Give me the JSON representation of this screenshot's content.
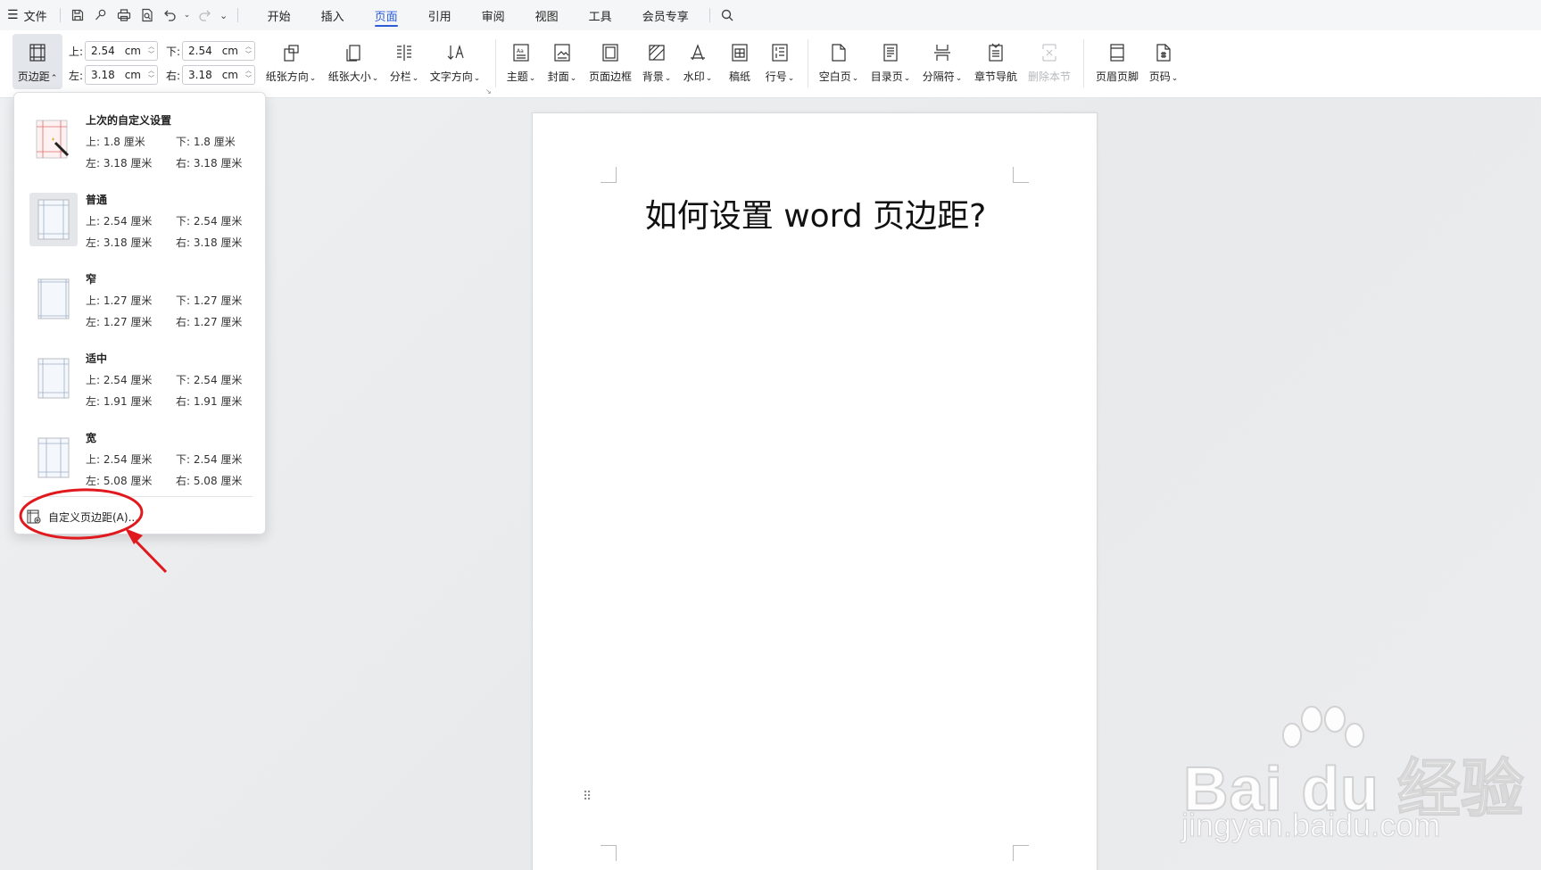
{
  "menubar": {
    "file_label": "文件",
    "tabs": [
      {
        "label": "开始"
      },
      {
        "label": "插入"
      },
      {
        "label": "页面"
      },
      {
        "label": "引用"
      },
      {
        "label": "审阅"
      },
      {
        "label": "视图"
      },
      {
        "label": "工具"
      },
      {
        "label": "会员专享"
      }
    ],
    "active_tab": "页面"
  },
  "ribbon": {
    "margins_button": "页边距",
    "fields": {
      "top": {
        "label": "上:",
        "value": "2.54",
        "unit": "cm"
      },
      "bottom": {
        "label": "下:",
        "value": "2.54",
        "unit": "cm"
      },
      "left": {
        "label": "左:",
        "value": "3.18",
        "unit": "cm"
      },
      "right": {
        "label": "右:",
        "value": "3.18",
        "unit": "cm"
      }
    },
    "buttons": {
      "orientation": "纸张方向",
      "size": "纸张大小",
      "columns": "分栏",
      "text_direction": "文字方向",
      "theme": "主题",
      "cover": "封面",
      "page_border": "页面边框",
      "background": "背景",
      "watermark": "水印",
      "manuscript": "稿纸",
      "line_number": "行号",
      "blank_page": "空白页",
      "toc_page": "目录页",
      "breaks": "分隔符",
      "chapter_nav": "章节导航",
      "delete_section": "删除本节",
      "header_footer": "页眉页脚",
      "page_number": "页码"
    }
  },
  "dropdown": {
    "presets": [
      {
        "name": "上次的自定义设置",
        "top": "上: 1.8 厘米",
        "bottom": "下: 1.8 厘米",
        "left": "左: 3.18 厘米",
        "right": "右: 3.18 厘米"
      },
      {
        "name": "普通",
        "top": "上: 2.54 厘米",
        "bottom": "下: 2.54 厘米",
        "left": "左: 3.18 厘米",
        "right": "右: 3.18 厘米"
      },
      {
        "name": "窄",
        "top": "上: 1.27 厘米",
        "bottom": "下: 1.27 厘米",
        "left": "左: 1.27 厘米",
        "right": "右: 1.27 厘米"
      },
      {
        "name": "适中",
        "top": "上: 2.54 厘米",
        "bottom": "下: 2.54 厘米",
        "left": "左: 1.91 厘米",
        "right": "右: 1.91 厘米"
      },
      {
        "name": "宽",
        "top": "上: 2.54 厘米",
        "bottom": "下: 2.54 厘米",
        "left": "左: 5.08 厘米",
        "right": "右: 5.08 厘米"
      }
    ],
    "selected_preset": "普通",
    "custom_label": "自定义页边距(A)..."
  },
  "document": {
    "title": "如何设置 word 页边距?"
  },
  "watermark": {
    "brand": "Bai du 经验",
    "url": "jingyan.baidu.com"
  },
  "colors": {
    "accent": "#2b5bd7",
    "annotation": "#e0191e"
  }
}
